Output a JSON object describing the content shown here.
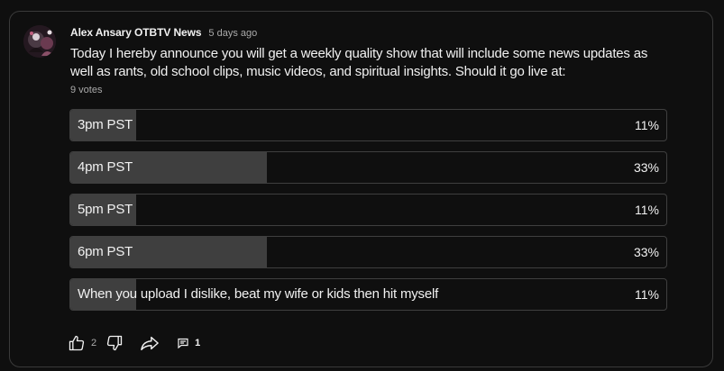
{
  "post": {
    "author": "Alex Ansary OTBTV News",
    "time": "5 days ago",
    "text": "Today I hereby announce you will get a weekly quality show that will include some news updates as well as rants, old school clips, music videos, and spiritual insights. Should it go live at:",
    "votes": "9 votes"
  },
  "poll": {
    "options": [
      {
        "label": "3pm PST",
        "percent_text": "11%",
        "percent": 11
      },
      {
        "label": "4pm PST",
        "percent_text": "33%",
        "percent": 33
      },
      {
        "label": "5pm PST",
        "percent_text": "11%",
        "percent": 11
      },
      {
        "label": "6pm PST",
        "percent_text": "33%",
        "percent": 33
      },
      {
        "label": "When you upload I dislike, beat my wife or kids then hit myself",
        "percent_text": "11%",
        "percent": 11
      }
    ]
  },
  "actions": {
    "like_icon": "thumbs-up-icon",
    "like_count": "2",
    "dislike_icon": "thumbs-down-icon",
    "share_icon": "share-icon",
    "comment_icon": "comment-icon",
    "comment_count": "1"
  },
  "colors": {
    "background": "#0f0f0f",
    "border": "#3a3a3a",
    "poll_fill": "#3f3f3f",
    "text_primary": "#f1f1f1",
    "text_secondary": "#aaaaaa"
  }
}
